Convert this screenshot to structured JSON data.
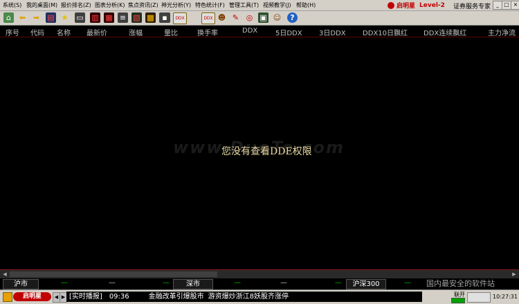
{
  "menu": [
    "系统(S)",
    "我的桌面(M)",
    "报价排名(Z)",
    "图表分析(K)",
    "焦点资讯(Z)",
    "神光分析(Y)",
    "特色统计(F)",
    "管理工具(T)",
    "视频教学(J)",
    "帮助(H)"
  ],
  "brand": {
    "name": "启明星",
    "level": "Level-2",
    "expert": "证券服务专家"
  },
  "window_controls": [
    "_",
    "□",
    "×"
  ],
  "toolbar_icons": [
    "home-icon",
    "back-arrow-icon",
    "forward-arrow-icon",
    "chart-icon",
    "star-icon",
    "monitor-icon",
    "kline-icon",
    "bar-chart-icon",
    "list-icon",
    "table-icon",
    "grid-icon",
    "ddx-icon",
    "ddx-icon",
    "user-icon",
    "pen-icon",
    "target-icon",
    "portfolio-icon",
    "people-icon",
    "help-icon"
  ],
  "toolbar_labels": {
    "ddx1": "DDX",
    "ddx2": "DDX",
    "help": "?"
  },
  "columns": [
    "序号",
    "代码",
    "名称",
    "最新价",
    "涨幅",
    "量比",
    "换手率",
    "DDX",
    "5日DDX",
    "3日DDX",
    "DDX10日飘红",
    "DDX连续飘红",
    "主力净流"
  ],
  "notice": "您没有查看DDE权限",
  "watermark": "www.DuoTe.com",
  "indices": [
    {
      "name": "沪市",
      "values": [
        "—",
        "—",
        "—"
      ]
    },
    {
      "name": "深市",
      "values": [
        "—",
        "—",
        "—"
      ]
    },
    {
      "name": "沪深300",
      "values": [
        "—"
      ]
    }
  ],
  "slogan": "国内最安全的软件站",
  "status": {
    "logo": "启明星",
    "ticker_label": "[实时播报]",
    "ticker_time": "09:36",
    "ticker_text1": "金融改革引爆股市",
    "ticker_text2": "游资爆炒浙江8妖股齐涨停",
    "connection": "联开",
    "clock": "10:27:31"
  },
  "colors": {
    "brand_red": "#c00000",
    "notice": "#e8d8a0",
    "positive": "#00c000"
  }
}
